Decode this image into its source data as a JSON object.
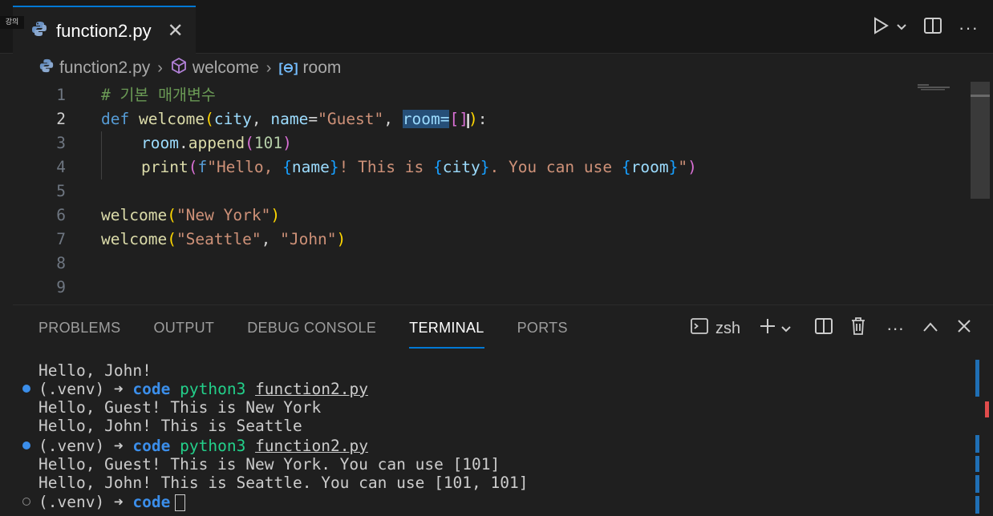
{
  "badge": "강의",
  "tab": {
    "filename": "function2.py"
  },
  "breadcrumb": {
    "file": "function2.py",
    "symbol": "welcome",
    "variable": "room"
  },
  "editor": {
    "line_numbers": [
      "1",
      "2",
      "3",
      "4",
      "5",
      "6",
      "7",
      "8",
      "9"
    ],
    "lines": {
      "l1": "# 기본 매개변수",
      "l2_def": "def",
      "l2_fn": "welcome",
      "l2_p1": "city",
      "l2_p2": "name",
      "l2_s1": "\"Guest\"",
      "l2_sel": "room=",
      "l2_rest": "[]",
      "l3_obj": "room",
      "l3_m": "append",
      "l3_n": "101",
      "l4_fn": "print",
      "l4_f": "f\"Hello, ",
      "l4_v1": "name",
      "l4_s2": "! This is ",
      "l4_v2": "city",
      "l4_s3": ". You can use ",
      "l4_v3": "room",
      "l6_fn": "welcome",
      "l6_s": "\"New York\"",
      "l7_fn": "welcome",
      "l7_s1": "\"Seattle\"",
      "l7_s2": "\"John\""
    }
  },
  "panel": {
    "tabs": [
      "PROBLEMS",
      "OUTPUT",
      "DEBUG CONSOLE",
      "TERMINAL",
      "PORTS"
    ],
    "active_tab": "TERMINAL",
    "shell": "zsh"
  },
  "terminal": {
    "out1": "Hello, John!",
    "prompt_env": "(.venv) ➜ ",
    "prompt_dir": "code",
    "cmd_bin": "python3",
    "cmd_file": "function2.py",
    "out2": "Hello, Guest! This is New York",
    "out3": "Hello, John! This is Seattle",
    "out4": "Hello, Guest! This is New York. You can use [101]",
    "out5": "Hello, John! This is Seattle. You can use [101, 101]"
  },
  "colors": {
    "accent": "#0078d4",
    "success_dot": "#3b8eea"
  },
  "icons": [
    "python-file-icon",
    "close-icon",
    "run-icon",
    "chevron-down-icon",
    "split-editor-icon",
    "more-icon",
    "symbol-method-icon",
    "symbol-variable-icon",
    "terminal-icon",
    "plus-icon",
    "trash-icon",
    "chevron-up-icon"
  ]
}
